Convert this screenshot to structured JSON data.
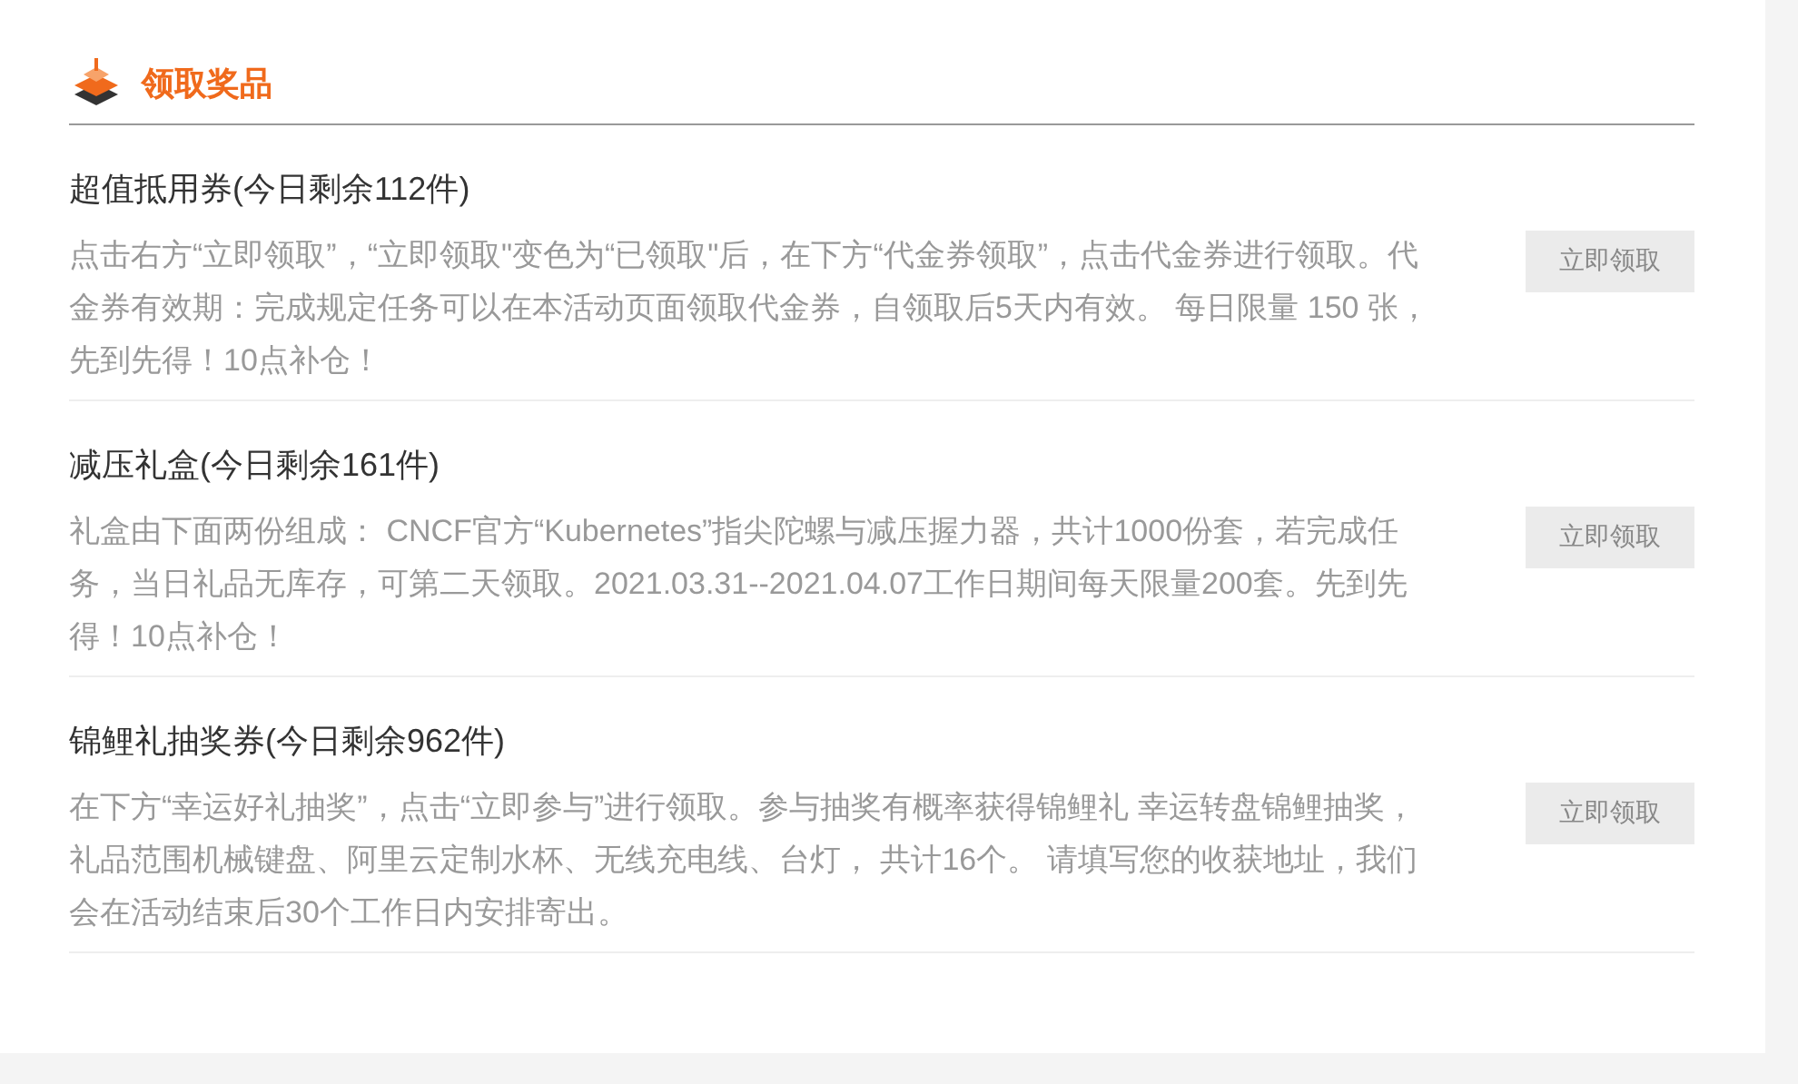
{
  "section": {
    "title": "领取奖品"
  },
  "prizes": [
    {
      "title": "超值抵用券(今日剩余112件)",
      "description": "点击右方“立即领取”，“立即领取\"变色为“已领取\"后，在下方“代金券领取”，点击代金券进行领取。代金券有效期：完成规定任务可以在本活动页面领取代金券，自领取后5天内有效。 每日限量 150 张，先到先得！10点补仓！",
      "button": "立即领取"
    },
    {
      "title": "减压礼盒(今日剩余161件)",
      "description": "礼盒由下面两份组成： CNCF官方“Kubernetes”指尖陀螺与减压握力器，共计1000份套，若完成任务，当日礼品无库存，可第二天领取。2021.03.31--2021.04.07工作日期间每天限量200套。先到先得！10点补仓！",
      "button": "立即领取"
    },
    {
      "title": "锦鲤礼抽奖券(今日剩余962件)",
      "description": "在下方“幸运好礼抽奖”，点击“立即参与”进行领取。参与抽奖有概率获得锦鲤礼 幸运转盘锦鲤抽奖，礼品范围机械键盘、阿里云定制水杯、无线充电线、台灯， 共计16个。 请填写您的收获地址，我们会在活动结束后30个工作日内安排寄出。",
      "button": "立即领取"
    }
  ]
}
